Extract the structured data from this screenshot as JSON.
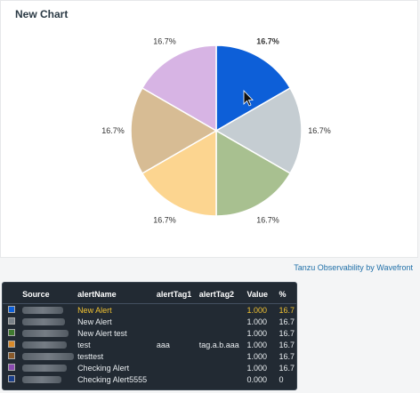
{
  "chart_data": {
    "type": "pie",
    "title": "New Chart",
    "slices": [
      {
        "label": "16.7%",
        "value": 16.7,
        "color": "#0d5fd8",
        "bold": true
      },
      {
        "label": "16.7%",
        "value": 16.7,
        "color": "#c5cdd2"
      },
      {
        "label": "16.7%",
        "value": 16.7,
        "color": "#a8c090"
      },
      {
        "label": "16.7%",
        "value": 16.7,
        "color": "#fcd590"
      },
      {
        "label": "16.7%",
        "value": 16.7,
        "color": "#d7bc94"
      },
      {
        "label": "16.7%",
        "value": 16.7,
        "color": "#d7b4e4"
      }
    ]
  },
  "footer": {
    "link": "Tanzu Observability by Wavefront"
  },
  "legend": {
    "headers": [
      "Source",
      "alertName",
      "alertTag1",
      "alertTag2",
      "Value",
      "%"
    ],
    "rows": [
      {
        "color": "#0d5fd8",
        "alertName": "New Alert",
        "alertTag1": "",
        "alertTag2": "",
        "value": "1.000",
        "pct": "16.7",
        "highlight": true
      },
      {
        "color": "#7a8288",
        "alertName": "New Alert",
        "alertTag1": "",
        "alertTag2": "",
        "value": "1.000",
        "pct": "16.7"
      },
      {
        "color": "#3f7a2f",
        "alertName": "New Alert test",
        "alertTag1": "",
        "alertTag2": "",
        "value": "1.000",
        "pct": "16.7"
      },
      {
        "color": "#d88a2a",
        "alertName": "test",
        "alertTag1": "aaa",
        "alertTag2": "tag.a.b.aaa",
        "value": "1.000",
        "pct": "16.7"
      },
      {
        "color": "#8a5a2a",
        "alertName": "testtest",
        "alertTag1": "",
        "alertTag2": "",
        "value": "1.000",
        "pct": "16.7"
      },
      {
        "color": "#8a4ab0",
        "alertName": "Checking Alert",
        "alertTag1": "",
        "alertTag2": "",
        "value": "1.000",
        "pct": "16.7"
      },
      {
        "color": "#1a3f8a",
        "alertName": "Checking Alert5555",
        "alertTag1": "",
        "alertTag2": "",
        "value": "0.000",
        "pct": "0"
      }
    ]
  }
}
